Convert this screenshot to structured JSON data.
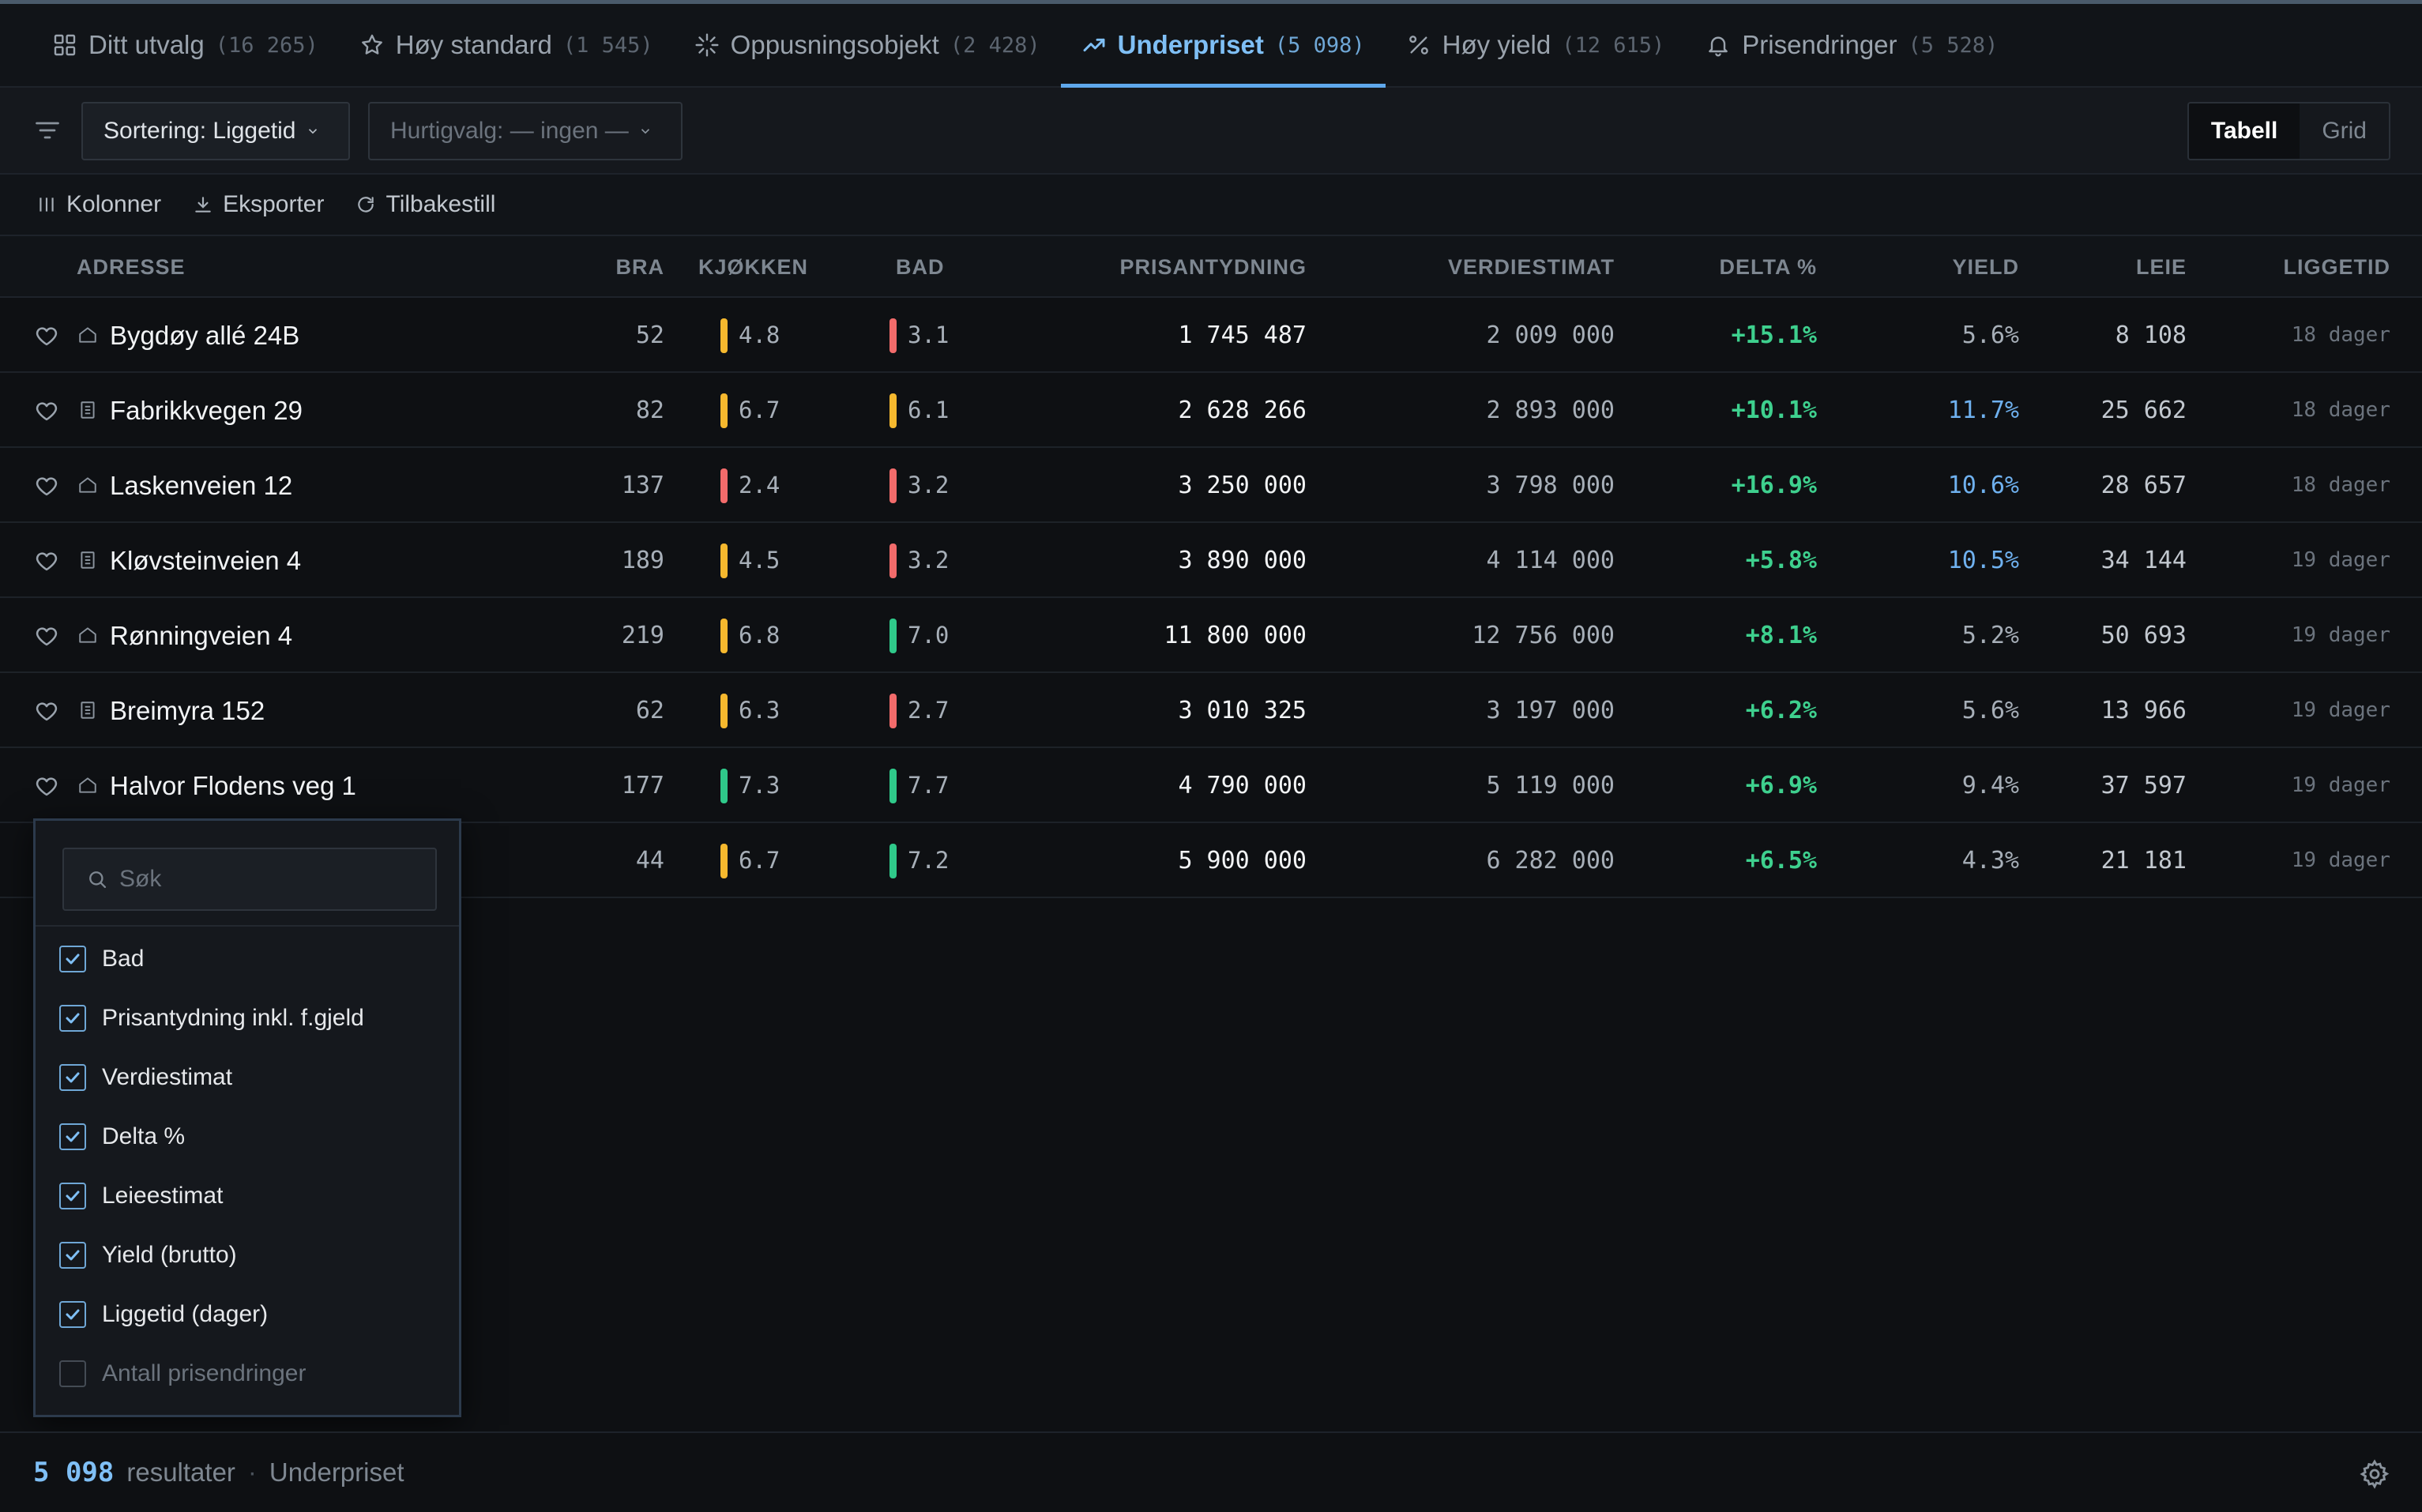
{
  "tabs": [
    {
      "label": "Ditt utvalg",
      "count": "(16 265)",
      "icon": "grid-icon"
    },
    {
      "label": "Høy standard",
      "count": "(1 545)",
      "icon": "star-icon"
    },
    {
      "label": "Oppusningsobjekt",
      "count": "(2 428)",
      "icon": "sparkle-icon"
    },
    {
      "label": "Underpriset",
      "count": "(5 098)",
      "icon": "trending-up-icon"
    },
    {
      "label": "Høy yield",
      "count": "(12 615)",
      "icon": "percent-icon"
    },
    {
      "label": "Prisendringer",
      "count": "(5 528)",
      "icon": "bell-icon"
    }
  ],
  "active_tab": "Underpriset",
  "filters": {
    "sort_label": "Sortering: Liggetid",
    "quick_label": "Hurtigvalg: — ingen —"
  },
  "view_toggle": {
    "table": "Tabell",
    "grid": "Grid",
    "selected": "Tabell"
  },
  "toolbar": {
    "columns": "Kolonner",
    "export": "Eksporter",
    "reset": "Tilbakestill"
  },
  "columns": {
    "adresse": "ADRESSE",
    "bra": "BRA",
    "kjokken": "KJØKKEN",
    "bad": "BAD",
    "prisantydning": "PRISANTYDNING",
    "verdiestimat": "VERDIESTIMAT",
    "delta": "DELTA %",
    "yield": "YIELD",
    "leie": "LEIE",
    "liggetid": "LIGGETID"
  },
  "rows": [
    {
      "address": "Bygdøy allé 24B",
      "type": "house",
      "bra": "52",
      "kitchen": "4.8",
      "kitchen_color": "#f5b82e",
      "bath": "3.1",
      "bath_color": "#f26b6b",
      "price": "1 745 487",
      "estimate": "2 009 000",
      "delta": "+15.1%",
      "yield": "5.6%",
      "yield_color": "#a7afb8",
      "rent": "8 108",
      "days": "18 dager"
    },
    {
      "address": "Fabrikkvegen 29",
      "type": "apartment",
      "bra": "82",
      "kitchen": "6.7",
      "kitchen_color": "#f5b82e",
      "bath": "6.1",
      "bath_color": "#f5b82e",
      "price": "2 628 266",
      "estimate": "2 893 000",
      "delta": "+10.1%",
      "yield": "11.7%",
      "yield_color": "#6fb1ef",
      "rent": "25 662",
      "days": "18 dager"
    },
    {
      "address": "Laskenveien 12",
      "type": "house",
      "bra": "137",
      "kitchen": "2.4",
      "kitchen_color": "#f26b6b",
      "bath": "3.2",
      "bath_color": "#f26b6b",
      "price": "3 250 000",
      "estimate": "3 798 000",
      "delta": "+16.9%",
      "yield": "10.6%",
      "yield_color": "#6fb1ef",
      "rent": "28 657",
      "days": "18 dager"
    },
    {
      "address": "Kløvsteinveien 4",
      "type": "apartment",
      "bra": "189",
      "kitchen": "4.5",
      "kitchen_color": "#f5b82e",
      "bath": "3.2",
      "bath_color": "#f26b6b",
      "price": "3 890 000",
      "estimate": "4 114 000",
      "delta": "+5.8%",
      "yield": "10.5%",
      "yield_color": "#6fb1ef",
      "rent": "34 144",
      "days": "19 dager"
    },
    {
      "address": "Rønningveien 4",
      "type": "house",
      "bra": "219",
      "kitchen": "6.8",
      "kitchen_color": "#f5b82e",
      "bath": "7.0",
      "bath_color": "#2fc98a",
      "price": "11 800 000",
      "estimate": "12 756 000",
      "delta": "+8.1%",
      "yield": "5.2%",
      "yield_color": "#a7afb8",
      "rent": "50 693",
      "days": "19 dager"
    },
    {
      "address": "Breimyra 152",
      "type": "apartment",
      "bra": "62",
      "kitchen": "6.3",
      "kitchen_color": "#f5b82e",
      "bath": "2.7",
      "bath_color": "#f26b6b",
      "price": "3 010 325",
      "estimate": "3 197 000",
      "delta": "+6.2%",
      "yield": "5.6%",
      "yield_color": "#a7afb8",
      "rent": "13 966",
      "days": "19 dager"
    },
    {
      "address": "Halvor Flodens veg 1",
      "type": "house",
      "bra": "177",
      "kitchen": "7.3",
      "kitchen_color": "#2fc98a",
      "bath": "7.7",
      "bath_color": "#2fc98a",
      "price": "4 790 000",
      "estimate": "5 119 000",
      "delta": "+6.9%",
      "yield": "9.4%",
      "yield_color": "#a7afb8",
      "rent": "37 597",
      "days": "19 dager"
    },
    {
      "address": "",
      "type": "apartment",
      "bra": "44",
      "kitchen": "6.7",
      "kitchen_color": "#f5b82e",
      "bath": "7.2",
      "bath_color": "#2fc98a",
      "price": "5 900 000",
      "estimate": "6 282 000",
      "delta": "+6.5%",
      "yield": "4.3%",
      "yield_color": "#a7afb8",
      "rent": "21 181",
      "days": "19 dager"
    }
  ],
  "column_picker": {
    "search_placeholder": "Søk",
    "options": [
      {
        "label": "Bad",
        "checked": true
      },
      {
        "label": "Prisantydning inkl. f.gjeld",
        "checked": true
      },
      {
        "label": "Verdiestimat",
        "checked": true
      },
      {
        "label": "Delta %",
        "checked": true
      },
      {
        "label": "Leieestimat",
        "checked": true
      },
      {
        "label": "Yield (brutto)",
        "checked": true
      },
      {
        "label": "Liggetid (dager)",
        "checked": true
      },
      {
        "label": "Antall prisendringer",
        "checked": false
      }
    ]
  },
  "footer": {
    "count": "5 098",
    "results_label": "resultater",
    "separator": "·",
    "view": "Underpriset"
  },
  "colors": {
    "accent": "#5fa8ec",
    "positive": "#3ed08e",
    "warn": "#f5b82e",
    "bad": "#f26b6b"
  }
}
